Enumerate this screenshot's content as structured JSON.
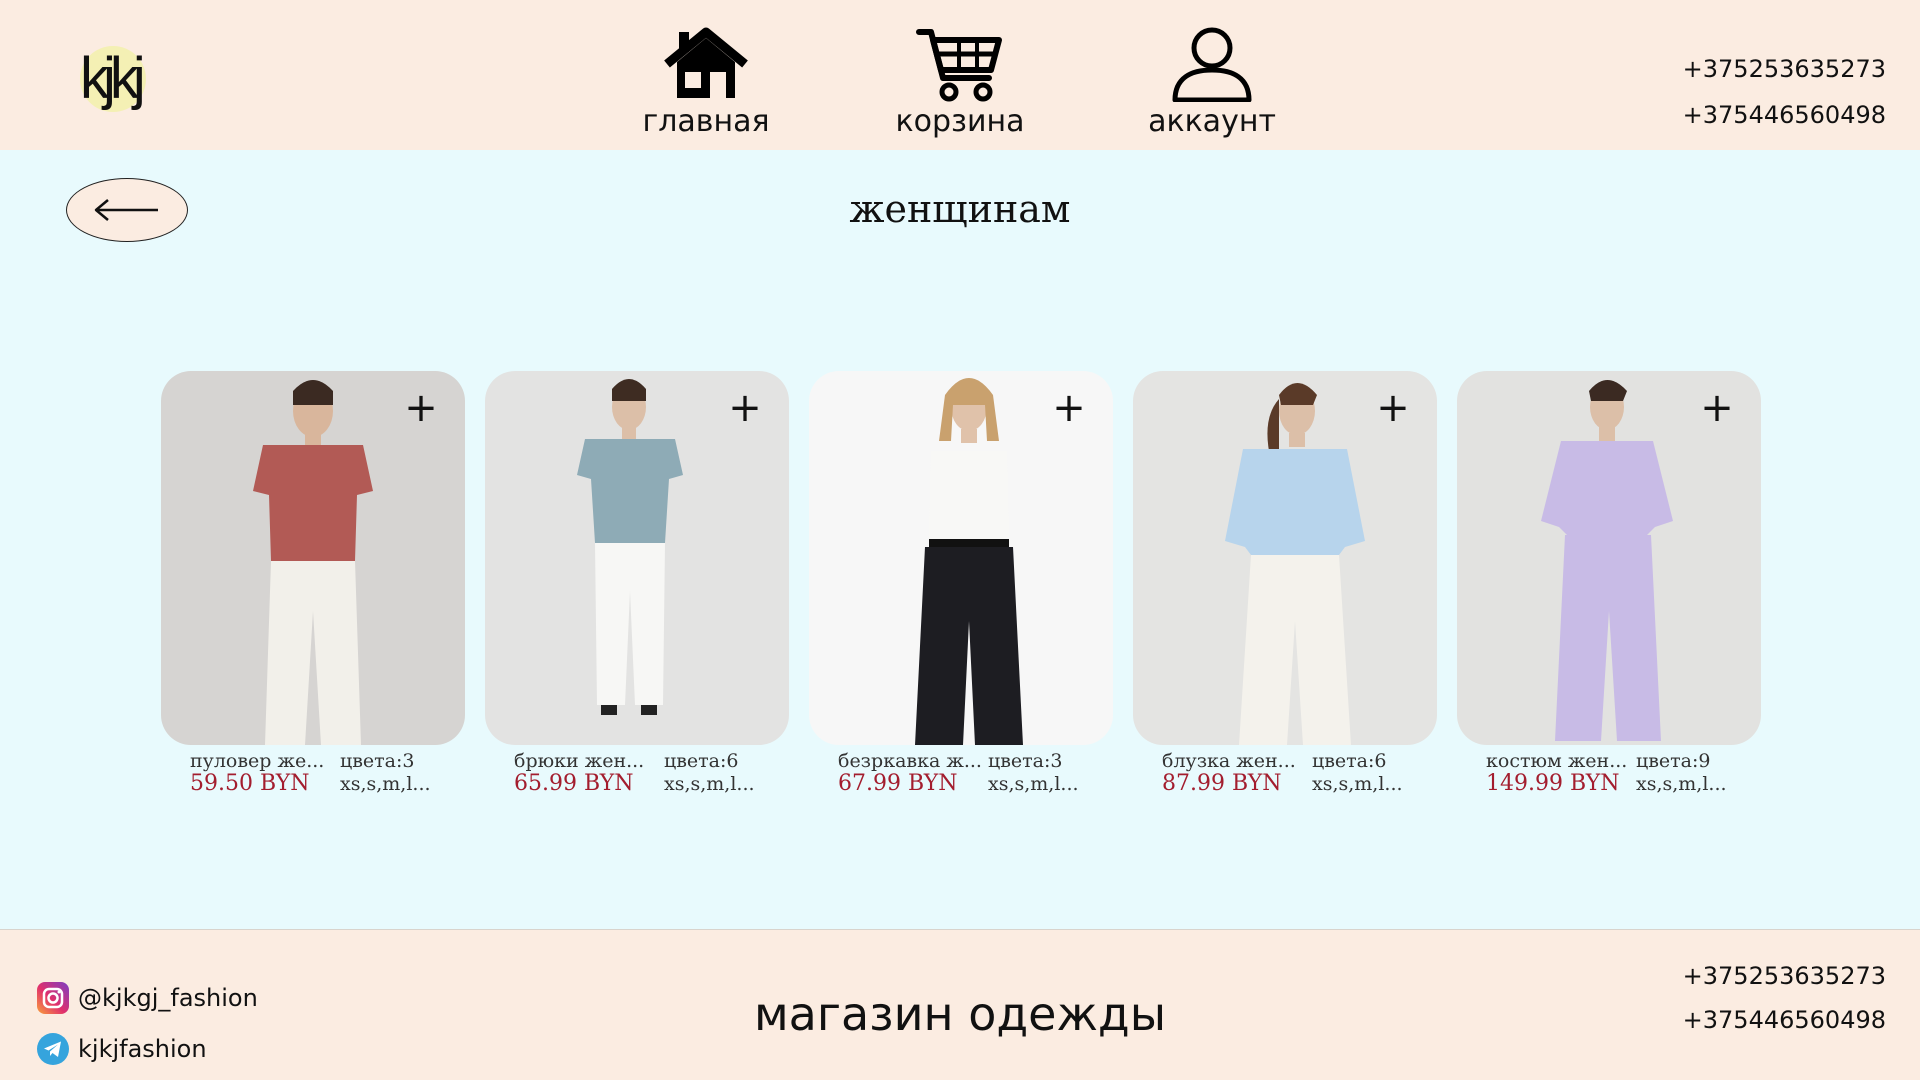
{
  "header": {
    "logo_text": "kjkj",
    "nav": [
      {
        "label": "главная",
        "icon": "home-icon"
      },
      {
        "label": "корзина",
        "icon": "cart-icon"
      },
      {
        "label": "аккаунт",
        "icon": "user-icon"
      }
    ],
    "phones": [
      "+375253635273",
      "+375446560498"
    ]
  },
  "main": {
    "back_icon": "arrow-left-icon",
    "title": "женщинам",
    "products": [
      {
        "name": "пуловер же...",
        "price": "59.50 BYN",
        "colors": "цвета:3",
        "sizes": "xs,s,m,l...",
        "top_color": "#b25a55",
        "bottom_color": "#f2f0ea",
        "bg": "#d6d4d2",
        "add": "+"
      },
      {
        "name": "брюки жен...",
        "price": "65.99 BYN",
        "colors": "цвета:6",
        "sizes": "xs,s,m,l...",
        "top_color": "#8eabb6",
        "bottom_color": "#f7f7f5",
        "bg": "#e3e3e2",
        "add": "+"
      },
      {
        "name": "безркавка ж...",
        "price": "67.99 BYN",
        "colors": "цвета:3",
        "sizes": "xs,s,m,l...",
        "top_color": "#f8f8f6",
        "bottom_color": "#1d1d22",
        "bg": "#f7f7f7",
        "add": "+"
      },
      {
        "name": "блузка жен...",
        "price": "87.99 BYN",
        "colors": "цвета:6",
        "sizes": "xs,s,m,l...",
        "top_color": "#b7d4ec",
        "bottom_color": "#f4f2ec",
        "bg": "#e4e4e2",
        "add": "+"
      },
      {
        "name": "костюм жен...",
        "price": "149.99 BYN",
        "colors": "цвета:9",
        "sizes": "xs,s,m,l...",
        "top_color": "#c8bbe6",
        "bottom_color": "#c8bbe6",
        "bg": "#e2e2e0",
        "add": "+"
      }
    ]
  },
  "footer": {
    "instagram": "@kjkgj_fashion",
    "telegram": "kjkjfashion",
    "title": "магазин одежды",
    "phones": [
      "+375253635273",
      "+375446560498"
    ]
  },
  "colors": {
    "header_bg": "#fbece1",
    "page_bg": "#e8fafd",
    "price": "#a31d2e"
  }
}
